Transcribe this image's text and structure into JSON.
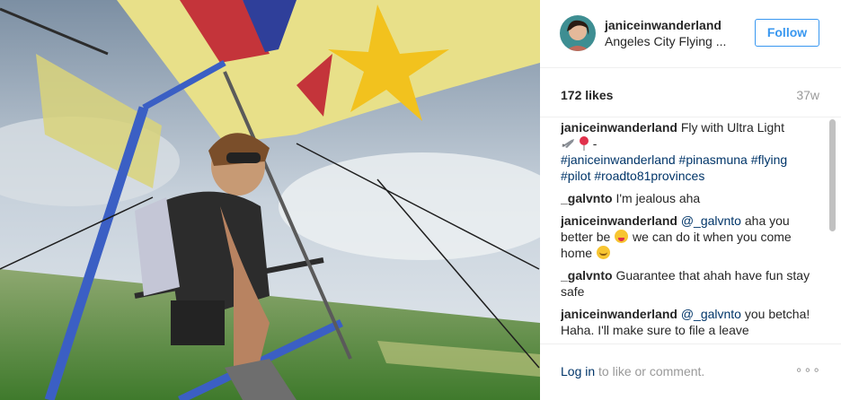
{
  "post": {
    "username": "janiceinwanderland",
    "location": "Angeles City Flying ...",
    "follow_label": "Follow",
    "likes": "172 likes",
    "time_ago": "37w"
  },
  "caption": {
    "author": "janiceinwanderland",
    "text": "Fly with Ultra Light",
    "emoji_suffix": " -",
    "hashtags": [
      "#janiceinwanderland",
      "#pinasmuna",
      "#flying",
      "#pilot",
      "#roadto81provinces"
    ]
  },
  "comments": [
    {
      "author": "_galvnto",
      "text": "I'm jealous aha"
    },
    {
      "author": "janiceinwanderland",
      "mention": "@_galvnto",
      "text_a": " aha you better be ",
      "text_b": " we can do it when you come home "
    },
    {
      "author": "_galvnto",
      "text": "Guarantee that ahah have fun stay safe"
    },
    {
      "author": "janiceinwanderland",
      "mention": "@_galvnto",
      "text": " you betcha! Haha. I'll make sure to file a leave"
    }
  ],
  "footer": {
    "login_label": "Log in",
    "login_suffix": " to like or comment.",
    "more_label": "∘∘∘"
  },
  "icons": {
    "avatar": "profile-avatar",
    "airplane": "airplane-emoji",
    "balloon": "balloon-emoji",
    "tongue": "tongue-face-emoji",
    "smile": "smile-emoji",
    "more": "more-options-icon"
  },
  "colors": {
    "accent": "#3897f0",
    "link": "#003569",
    "muted": "#999999",
    "text": "#262626"
  }
}
